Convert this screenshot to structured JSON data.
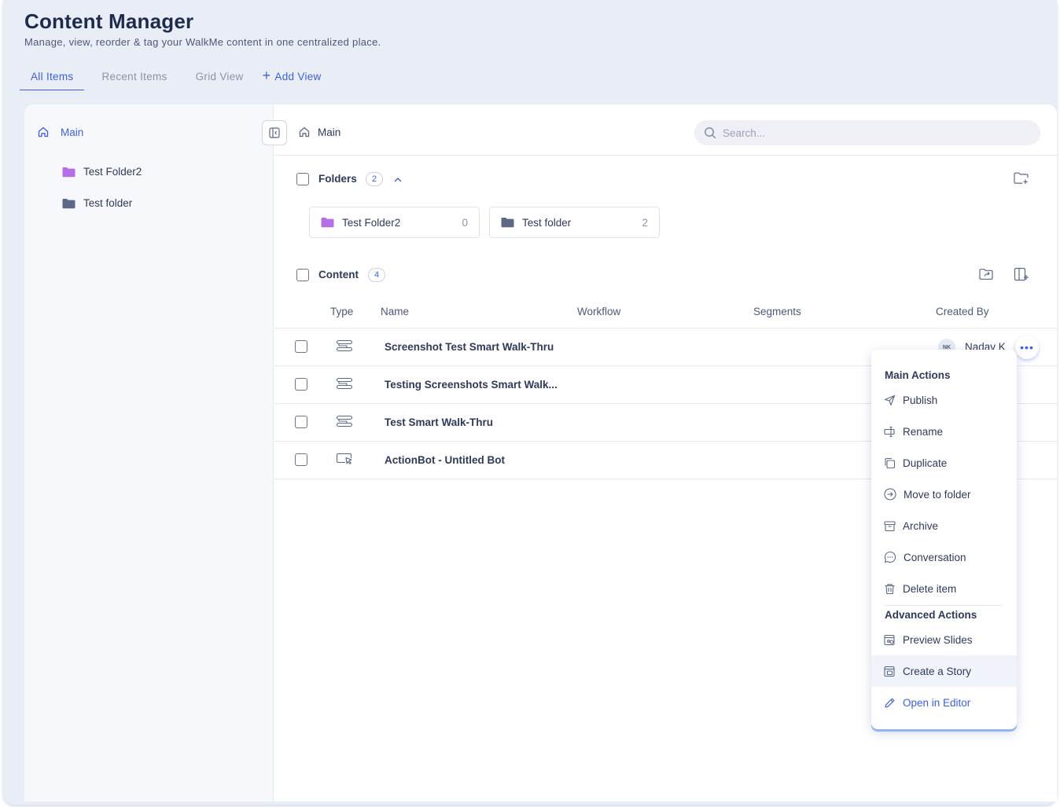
{
  "header": {
    "title": "Content Manager",
    "subtitle": "Manage, view, reorder & tag your WalkMe content in one centralized place."
  },
  "tabs": [
    {
      "label": "All Items",
      "active": true
    },
    {
      "label": "Recent Items",
      "active": false
    },
    {
      "label": "Grid View",
      "active": false
    }
  ],
  "add_view_label": "Add View",
  "sidebar": {
    "root_label": "Main",
    "folders": [
      {
        "label": "Test Folder2",
        "color": "#b46ee6"
      },
      {
        "label": "Test folder",
        "color": "#5b6886"
      }
    ]
  },
  "breadcrumb": {
    "label": "Main"
  },
  "search": {
    "placeholder": "Search..."
  },
  "folders_section": {
    "label": "Folders",
    "count": "2",
    "cards": [
      {
        "label": "Test Folder2",
        "count": "0",
        "color": "#b46ee6"
      },
      {
        "label": "Test folder",
        "count": "2",
        "color": "#5b6886"
      }
    ]
  },
  "content_section": {
    "label": "Content",
    "count": "4",
    "columns": [
      "Type",
      "Name",
      "Workflow",
      "Segments",
      "Created By"
    ],
    "rows": [
      {
        "type_icon": "smart-walkthru-icon",
        "name": "Screenshot Test Smart Walk-Thru",
        "created_by_initials": "NK",
        "created_by": "Nadav K"
      },
      {
        "type_icon": "smart-walkthru-icon",
        "name": "Testing Screenshots Smart Walk..."
      },
      {
        "type_icon": "smart-walkthru-icon",
        "name": "Test Smart Walk-Thru"
      },
      {
        "type_icon": "actionbot-icon",
        "name": "ActionBot - Untitled Bot"
      }
    ]
  },
  "context_menu": {
    "main_heading": "Main Actions",
    "main_items": [
      {
        "label": "Publish",
        "icon": "send-icon"
      },
      {
        "label": "Rename",
        "icon": "rename-icon"
      },
      {
        "label": "Duplicate",
        "icon": "duplicate-icon"
      },
      {
        "label": "Move to folder",
        "icon": "move-to-folder-icon"
      },
      {
        "label": "Archive",
        "icon": "archive-icon"
      },
      {
        "label": "Conversation",
        "icon": "conversation-icon"
      },
      {
        "label": "Delete item",
        "icon": "trash-icon"
      }
    ],
    "advanced_heading": "Advanced Actions",
    "advanced_items": [
      {
        "label": "Preview Slides",
        "icon": "preview-slides-icon"
      },
      {
        "label": "Create a Story",
        "icon": "create-story-icon"
      },
      {
        "label": "Open in Editor",
        "icon": "pencil-icon"
      }
    ]
  },
  "colors": {
    "accent": "#3b5fe0",
    "background": "#e9edf6",
    "text": "#2f3a5a"
  }
}
